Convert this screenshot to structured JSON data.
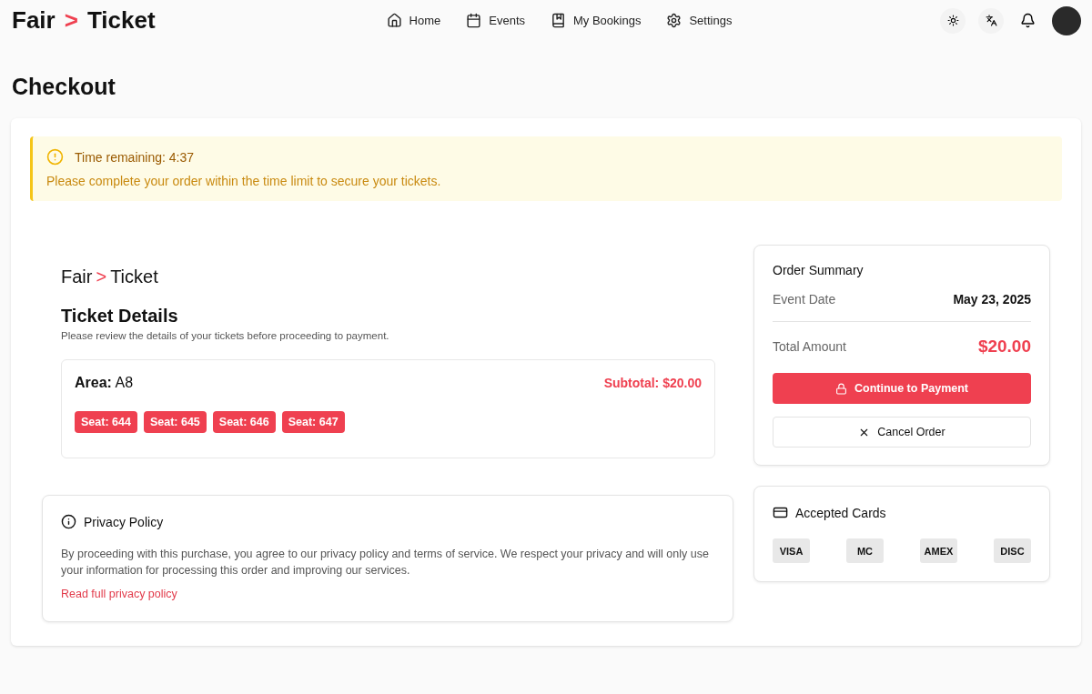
{
  "header": {
    "brand": [
      "Fair",
      ">",
      "Ticket"
    ],
    "nav": [
      {
        "label": "Home"
      },
      {
        "label": "Events"
      },
      {
        "label": "My Bookings"
      },
      {
        "label": "Settings"
      }
    ]
  },
  "page_title": "Checkout",
  "alert": {
    "title": "Time remaining: 4:37",
    "message": "Please complete your order within the time limit to secure your tickets."
  },
  "ticket": {
    "brand": [
      "Fair",
      ">",
      "Ticket"
    ],
    "title": "Ticket Details",
    "subtitle": "Please review the details of your tickets before proceeding to payment.",
    "area_label": "Area:",
    "area": "A8",
    "subtotal": "Subtotal: $20.00",
    "seats": [
      "Seat: 644",
      "Seat: 645",
      "Seat: 646",
      "Seat: 647"
    ]
  },
  "privacy": {
    "title": "Privacy Policy",
    "text": "By proceeding with this purchase, you agree to our privacy policy and terms of service. We respect your privacy and will only use your information for processing this order and improving our services.",
    "link": "Read full privacy policy"
  },
  "summary": {
    "title": "Order Summary",
    "rows": [
      {
        "label": "Event Date",
        "value": "May 23, 2025",
        "kind": "date"
      },
      {
        "label": "Total Amount",
        "value": "$20.00",
        "kind": "total"
      }
    ],
    "primary": "Continue to Payment",
    "secondary": "Cancel Order"
  },
  "cards": {
    "title": "Accepted Cards",
    "items": [
      "VISA",
      "MC",
      "AMEX",
      "DISC"
    ]
  }
}
